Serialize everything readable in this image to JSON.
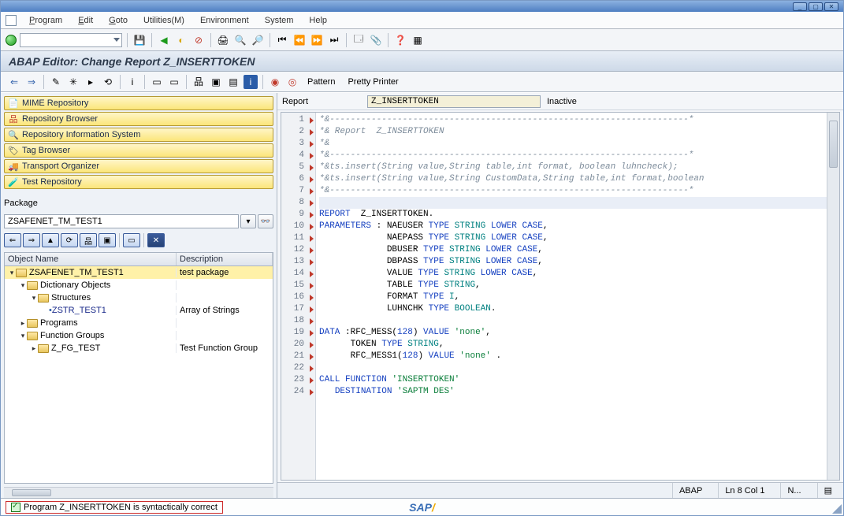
{
  "menu": {
    "program": "Program",
    "edit": "Edit",
    "goto": "Goto",
    "utilities": "Utilities(M)",
    "environment": "Environment",
    "system": "System",
    "help": "Help"
  },
  "title": "ABAP Editor: Change Report Z_INSERTTOKEN",
  "edtoolbar": {
    "pattern": "Pattern",
    "pretty": "Pretty Printer"
  },
  "repo_buttons": {
    "mime": "MIME Repository",
    "browser": "Repository Browser",
    "infosys": "Repository Information System",
    "tag": "Tag Browser",
    "transport": "Transport Organizer",
    "test": "Test Repository"
  },
  "package": {
    "label": "Package",
    "value": "ZSAFENET_TM_TEST1"
  },
  "objtable": {
    "headers": {
      "name": "Object Name",
      "desc": "Description"
    },
    "rows": [
      {
        "indent": 0,
        "twist": "▾",
        "icon": "pkg",
        "label": "ZSAFENET_TM_TEST1",
        "desc": "test package",
        "sel": true
      },
      {
        "indent": 1,
        "twist": "▾",
        "icon": "fld",
        "label": "Dictionary Objects",
        "desc": ""
      },
      {
        "indent": 2,
        "twist": "▾",
        "icon": "fld",
        "label": "Structures",
        "desc": ""
      },
      {
        "indent": 3,
        "twist": "",
        "icon": "dot",
        "label": "ZSTR_TEST1",
        "desc": "Array of Strings",
        "link": true
      },
      {
        "indent": 1,
        "twist": "▸",
        "icon": "fld",
        "label": "Programs",
        "desc": ""
      },
      {
        "indent": 1,
        "twist": "▾",
        "icon": "fld",
        "label": "Function Groups",
        "desc": ""
      },
      {
        "indent": 2,
        "twist": "▸",
        "icon": "fld",
        "label": "Z_FG_TEST",
        "desc": "Test Function Group"
      }
    ]
  },
  "report": {
    "label": "Report",
    "name": "Z_INSERTTOKEN",
    "status": "Inactive"
  },
  "code_lines": [
    {
      "n": 1,
      "cls": "cmt",
      "t": "*&---------------------------------------------------------------------*"
    },
    {
      "n": 2,
      "cls": "cmt",
      "t": "*& Report  Z_INSERTTOKEN"
    },
    {
      "n": 3,
      "cls": "cmt",
      "t": "*&"
    },
    {
      "n": 4,
      "cls": "cmt",
      "t": "*&---------------------------------------------------------------------*"
    },
    {
      "n": 5,
      "cls": "cmt",
      "t": "*&ts.insert(String value,String table,int format, boolean luhncheck);"
    },
    {
      "n": 6,
      "cls": "cmt",
      "t": "*&ts.insert(String value,String CustomData,String table,int format,boolean"
    },
    {
      "n": 7,
      "cls": "cmt",
      "t": "*&---------------------------------------------------------------------*"
    },
    {
      "n": 8,
      "cls": "hl",
      "t": ""
    },
    {
      "n": 9,
      "cls": "",
      "t": "REPORT  Z_INSERTTOKEN.",
      "html": "<span class='kw'>REPORT</span>  Z_INSERTTOKEN."
    },
    {
      "n": 10,
      "cls": "",
      "html": "<span class='kw'>PARAMETERS</span> : NAEUSER <span class='kw'>TYPE</span> <span class='ty'>STRING</span> <span class='kw'>LOWER CASE</span>,"
    },
    {
      "n": 11,
      "cls": "",
      "html": "             NAEPASS <span class='kw'>TYPE</span> <span class='ty'>STRING</span> <span class='kw'>LOWER CASE</span>,"
    },
    {
      "n": 12,
      "cls": "",
      "html": "             DBUSER <span class='kw'>TYPE</span> <span class='ty'>STRING</span> <span class='kw'>LOWER CASE</span>,"
    },
    {
      "n": 13,
      "cls": "",
      "html": "             DBPASS <span class='kw'>TYPE</span> <span class='ty'>STRING</span> <span class='kw'>LOWER CASE</span>,"
    },
    {
      "n": 14,
      "cls": "",
      "html": "             VALUE <span class='kw'>TYPE</span> <span class='ty'>STRING</span> <span class='kw'>LOWER CASE</span>,"
    },
    {
      "n": 15,
      "cls": "",
      "html": "             TABLE <span class='kw'>TYPE</span> <span class='ty'>STRING</span>,"
    },
    {
      "n": 16,
      "cls": "",
      "html": "             FORMAT <span class='kw'>TYPE</span> <span class='ty'>I</span>,"
    },
    {
      "n": 17,
      "cls": "",
      "html": "             LUHNCHK <span class='kw'>TYPE</span> <span class='ty'>BOOLEAN</span>."
    },
    {
      "n": 18,
      "cls": "",
      "html": ""
    },
    {
      "n": 19,
      "cls": "",
      "html": "<span class='kw'>DATA</span> :RFC_MESS(<span class='num'>128</span>) <span class='kw'>VALUE</span> <span class='str'>'none'</span>,"
    },
    {
      "n": 20,
      "cls": "",
      "html": "      TOKEN <span class='kw'>TYPE</span> <span class='ty'>STRING</span>,"
    },
    {
      "n": 21,
      "cls": "",
      "html": "      RFC_MESS1(<span class='num'>128</span>) <span class='kw'>VALUE</span> <span class='str'>'none'</span> ."
    },
    {
      "n": 22,
      "cls": "",
      "html": ""
    },
    {
      "n": 23,
      "cls": "",
      "html": "<span class='kw'>CALL FUNCTION</span> <span class='str'>'INSERTTOKEN'</span>"
    },
    {
      "n": 24,
      "cls": "",
      "html": "   <span class='kw'>DESTINATION</span> <span class='str'>'SAPTM DES'</span>"
    }
  ],
  "status": {
    "lang": "ABAP",
    "pos": "Ln  8 Col  1",
    "ovr": "N..."
  },
  "sysmsg": "Program Z_INSERTTOKEN is syntactically correct"
}
